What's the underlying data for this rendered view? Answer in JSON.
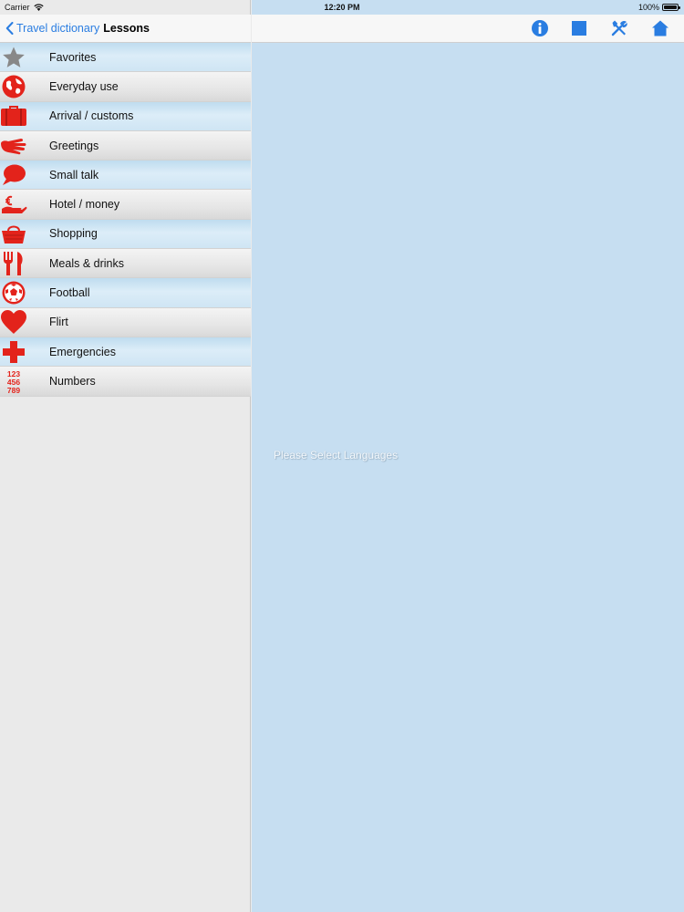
{
  "status": {
    "carrier": "Carrier",
    "time": "12:20 PM",
    "battery": "100%"
  },
  "left_nav": {
    "back_label": "Travel dictionary",
    "title": "Lessons"
  },
  "lessons": [
    {
      "label": "Favorites",
      "icon": "star-icon"
    },
    {
      "label": "Everyday use",
      "icon": "globe-icon"
    },
    {
      "label": "Arrival / customs",
      "icon": "suitcase-icon"
    },
    {
      "label": "Greetings",
      "icon": "hand-icon"
    },
    {
      "label": "Small talk",
      "icon": "speech-bubble-icon"
    },
    {
      "label": "Hotel / money",
      "icon": "money-icon"
    },
    {
      "label": "Shopping",
      "icon": "basket-icon"
    },
    {
      "label": "Meals & drinks",
      "icon": "fork-knife-icon"
    },
    {
      "label": "Football",
      "icon": "soccer-ball-icon"
    },
    {
      "label": "Flirt",
      "icon": "heart-icon"
    },
    {
      "label": "Emergencies",
      "icon": "red-cross-icon"
    },
    {
      "label": "Numbers",
      "icon": "numbers-icon"
    }
  ],
  "right_nav": {
    "icons": [
      "info-icon",
      "square-icon",
      "tools-icon",
      "home-icon"
    ]
  },
  "detail": {
    "placeholder": "Please Select Languages"
  },
  "colors": {
    "accent": "#2a7de1",
    "icon_red": "#e3231b",
    "detail_bg": "#c6def1"
  }
}
